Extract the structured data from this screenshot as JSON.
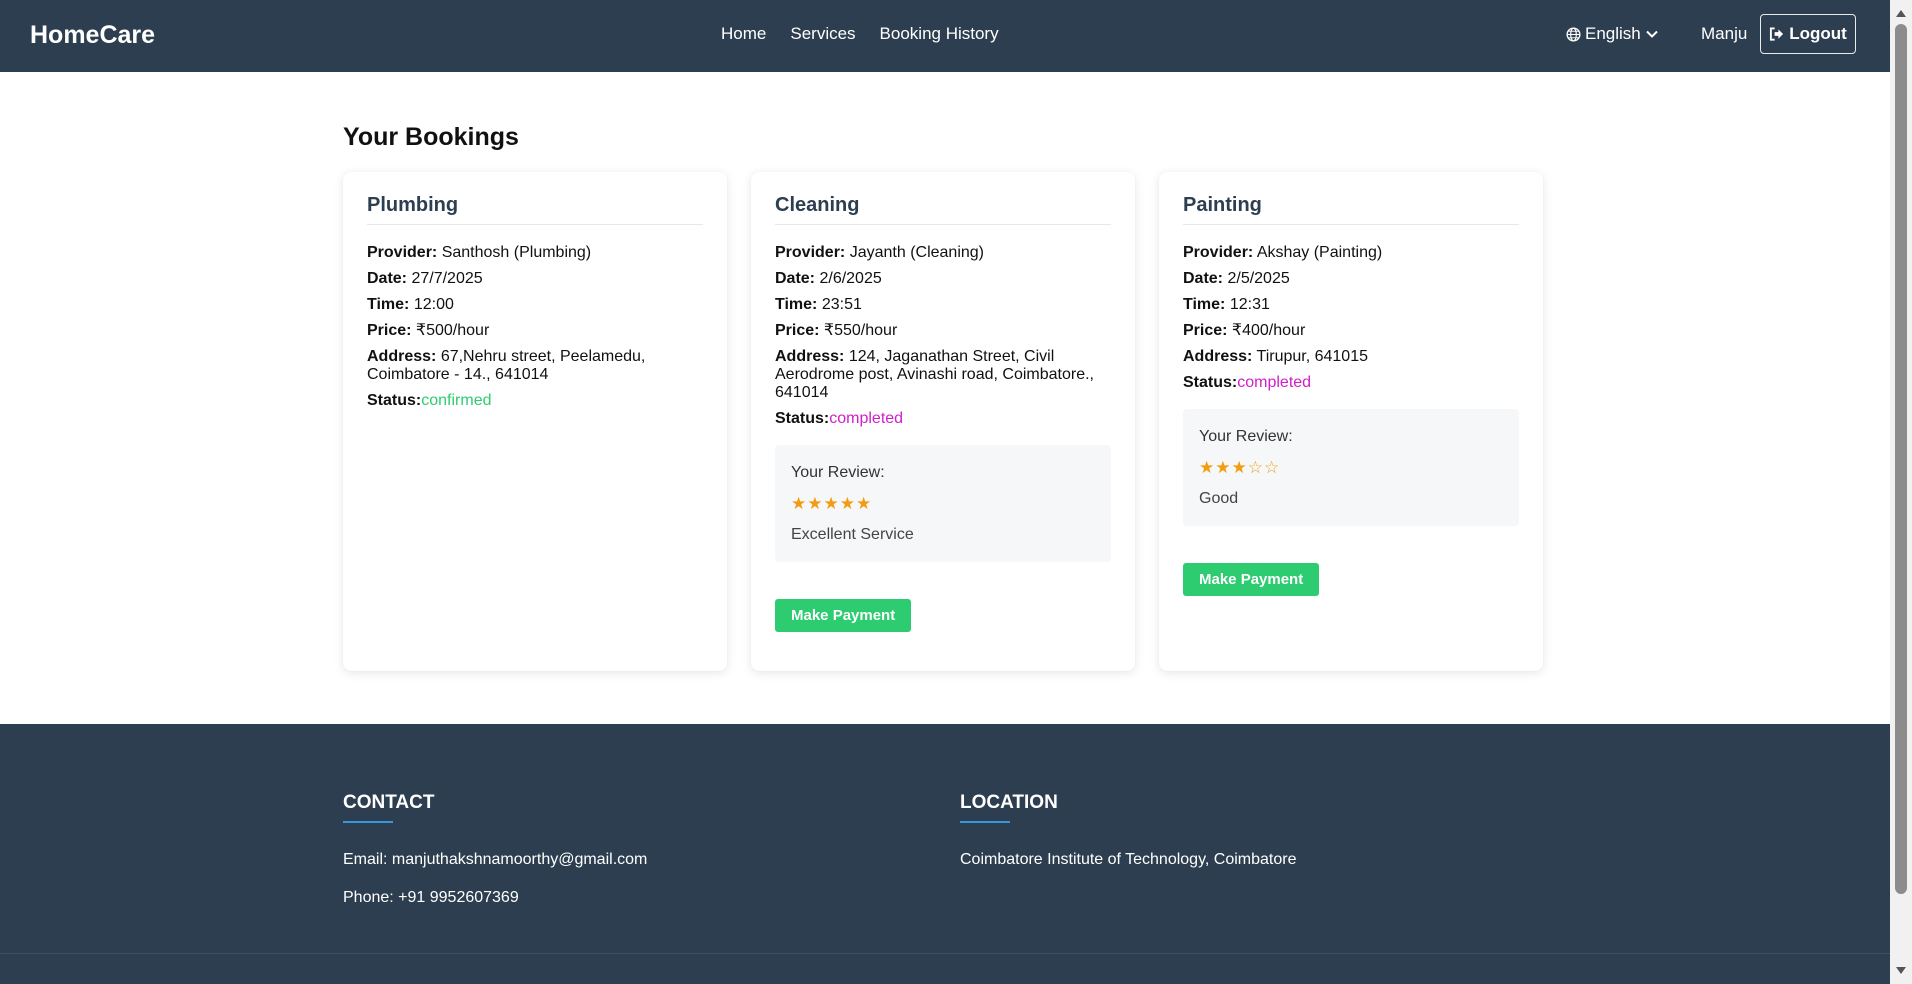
{
  "nav": {
    "brand": "HomeCare",
    "links": [
      "Home",
      "Services",
      "Booking History"
    ],
    "language": "English",
    "user": "Manju",
    "logout": "Logout"
  },
  "page_title": "Your Bookings",
  "labels": {
    "provider": "Provider:",
    "date": "Date:",
    "time": "Time:",
    "price": "Price:",
    "address": "Address:",
    "status": "Status:",
    "review": "Your Review:",
    "pay": "Make Payment"
  },
  "bookings": [
    {
      "service": "Plumbing",
      "provider": "Santhosh (Plumbing)",
      "date": "27/7/2025",
      "time": "12:00",
      "price": "₹500/hour",
      "address": "67,Nehru street, Peelamedu, Coimbatore - 14., 641014",
      "status": "confirmed"
    },
    {
      "service": "Cleaning",
      "provider": "Jayanth (Cleaning)",
      "date": "2/6/2025",
      "time": "23:51",
      "price": "₹550/hour",
      "address": "124, Jaganathan Street, Civil Aerodrome post, Avinashi road, Coimbatore., 641014",
      "status": "completed",
      "review": {
        "rating": 5,
        "max": 5,
        "comment": "Excellent Service"
      }
    },
    {
      "service": "Painting",
      "provider": "Akshay (Painting)",
      "date": "2/5/2025",
      "time": "12:31",
      "price": "₹400/hour",
      "address": "Tirupur, 641015",
      "status": "completed",
      "review": {
        "rating": 3,
        "max": 5,
        "comment": "Good"
      }
    }
  ],
  "footer": {
    "contact_heading": "CONTACT",
    "email": "Email: manjuthakshnamoorthy@gmail.com",
    "phone": "Phone: +91 9952607369",
    "location_heading": "LOCATION",
    "location": "Coimbatore Institute of Technology, Coimbatore"
  },
  "colors": {
    "nav_bg": "#2c3e50",
    "status_confirmed": "#2ecc71",
    "status_completed": "#d020c8",
    "pay_button": "#2ecc71",
    "star": "#f39c12",
    "footer_accent": "#3498db"
  },
  "icons": {
    "language": "globe-icon",
    "language_toggle": "chevron-down-icon",
    "logout": "logout-icon",
    "rating": "star-icon"
  }
}
